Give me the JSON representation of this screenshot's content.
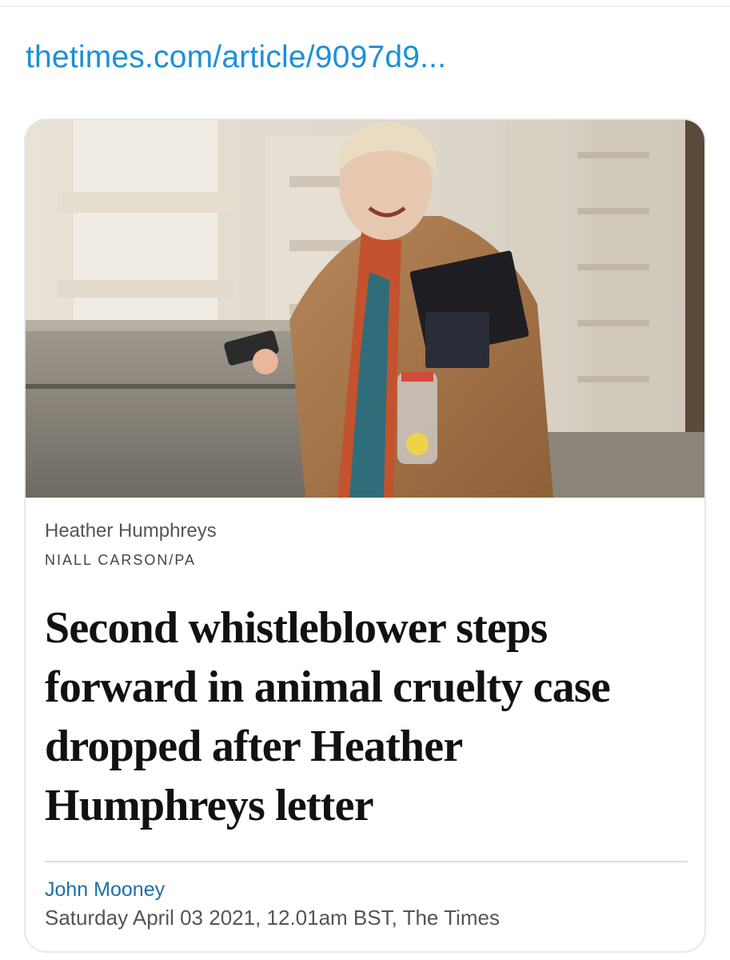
{
  "link": {
    "text": "thetimes.com/article/9097d9..."
  },
  "article": {
    "image_caption": "Heather Humphreys",
    "image_credit": "NIALL CARSON/PA",
    "headline": "Second whistleblower steps forward in animal cruelty case dropped after Heather Humphreys letter",
    "author": "John Mooney",
    "dateline": "Saturday April 03 2021, 12.01am BST, The Times"
  },
  "colors": {
    "link": "#1d8fd8",
    "author": "#1d6fa8",
    "headline": "#111111"
  },
  "icons": {
    "photo": "news-photo"
  }
}
